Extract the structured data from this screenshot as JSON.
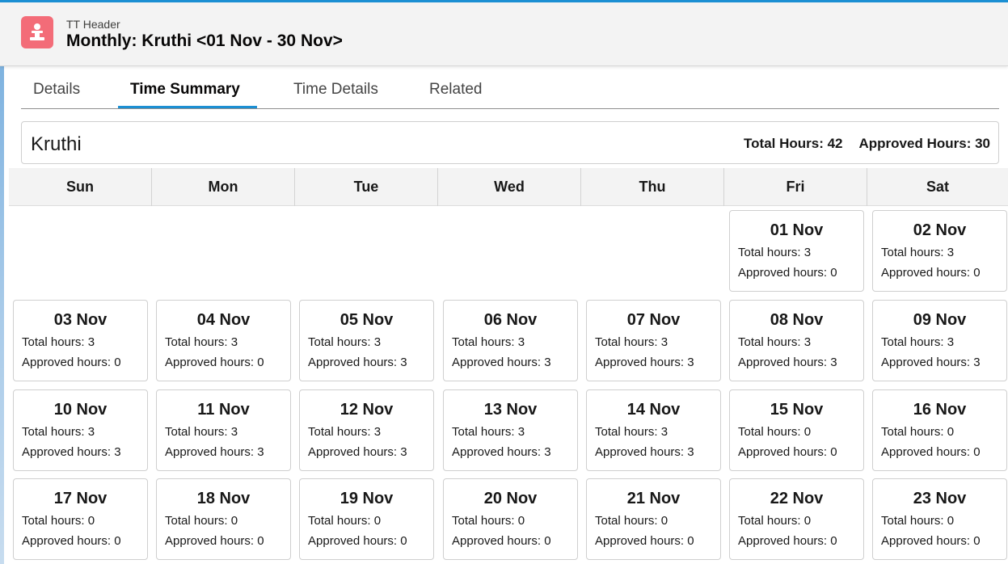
{
  "header": {
    "subtitle": "TT Header",
    "title": "Monthly: Kruthi <01 Nov - 30 Nov>",
    "icon": "timesheet-icon",
    "icon_color": "#f36c78",
    "accent_color": "#1b8fd3"
  },
  "tabs": [
    {
      "label": "Details",
      "active": false
    },
    {
      "label": "Time Summary",
      "active": true
    },
    {
      "label": "Time Details",
      "active": false
    },
    {
      "label": "Related",
      "active": false
    }
  ],
  "summary": {
    "name": "Kruthi",
    "total_hours": "Total Hours: 42",
    "approved_hours": "Approved Hours: 30"
  },
  "weekdays": [
    "Sun",
    "Mon",
    "Tue",
    "Wed",
    "Thu",
    "Fri",
    "Sat"
  ],
  "days": [
    {
      "date": "01 Nov",
      "total": "Total hours: 3",
      "approved": "Approved hours: 0"
    },
    {
      "date": "02 Nov",
      "total": "Total hours: 3",
      "approved": "Approved hours: 0"
    },
    {
      "date": "03 Nov",
      "total": "Total hours: 3",
      "approved": "Approved hours: 0"
    },
    {
      "date": "04 Nov",
      "total": "Total hours: 3",
      "approved": "Approved hours: 0"
    },
    {
      "date": "05 Nov",
      "total": "Total hours: 3",
      "approved": "Approved hours: 3"
    },
    {
      "date": "06 Nov",
      "total": "Total hours: 3",
      "approved": "Approved hours: 3"
    },
    {
      "date": "07 Nov",
      "total": "Total hours: 3",
      "approved": "Approved hours: 3"
    },
    {
      "date": "08 Nov",
      "total": "Total hours: 3",
      "approved": "Approved hours: 3"
    },
    {
      "date": "09 Nov",
      "total": "Total hours: 3",
      "approved": "Approved hours: 3"
    },
    {
      "date": "10 Nov",
      "total": "Total hours: 3",
      "approved": "Approved hours: 3"
    },
    {
      "date": "11 Nov",
      "total": "Total hours: 3",
      "approved": "Approved hours: 3"
    },
    {
      "date": "12 Nov",
      "total": "Total hours: 3",
      "approved": "Approved hours: 3"
    },
    {
      "date": "13 Nov",
      "total": "Total hours: 3",
      "approved": "Approved hours: 3"
    },
    {
      "date": "14 Nov",
      "total": "Total hours: 3",
      "approved": "Approved hours: 3"
    },
    {
      "date": "15 Nov",
      "total": "Total hours: 0",
      "approved": "Approved hours: 0"
    },
    {
      "date": "16 Nov",
      "total": "Total hours: 0",
      "approved": "Approved hours: 0"
    },
    {
      "date": "17 Nov",
      "total": "Total hours: 0",
      "approved": "Approved hours: 0"
    },
    {
      "date": "18 Nov",
      "total": "Total hours: 0",
      "approved": "Approved hours: 0"
    },
    {
      "date": "19 Nov",
      "total": "Total hours: 0",
      "approved": "Approved hours: 0"
    },
    {
      "date": "20 Nov",
      "total": "Total hours: 0",
      "approved": "Approved hours: 0"
    },
    {
      "date": "21 Nov",
      "total": "Total hours: 0",
      "approved": "Approved hours: 0"
    },
    {
      "date": "22 Nov",
      "total": "Total hours: 0",
      "approved": "Approved hours: 0"
    },
    {
      "date": "23 Nov",
      "total": "Total hours: 0",
      "approved": "Approved hours: 0"
    }
  ]
}
